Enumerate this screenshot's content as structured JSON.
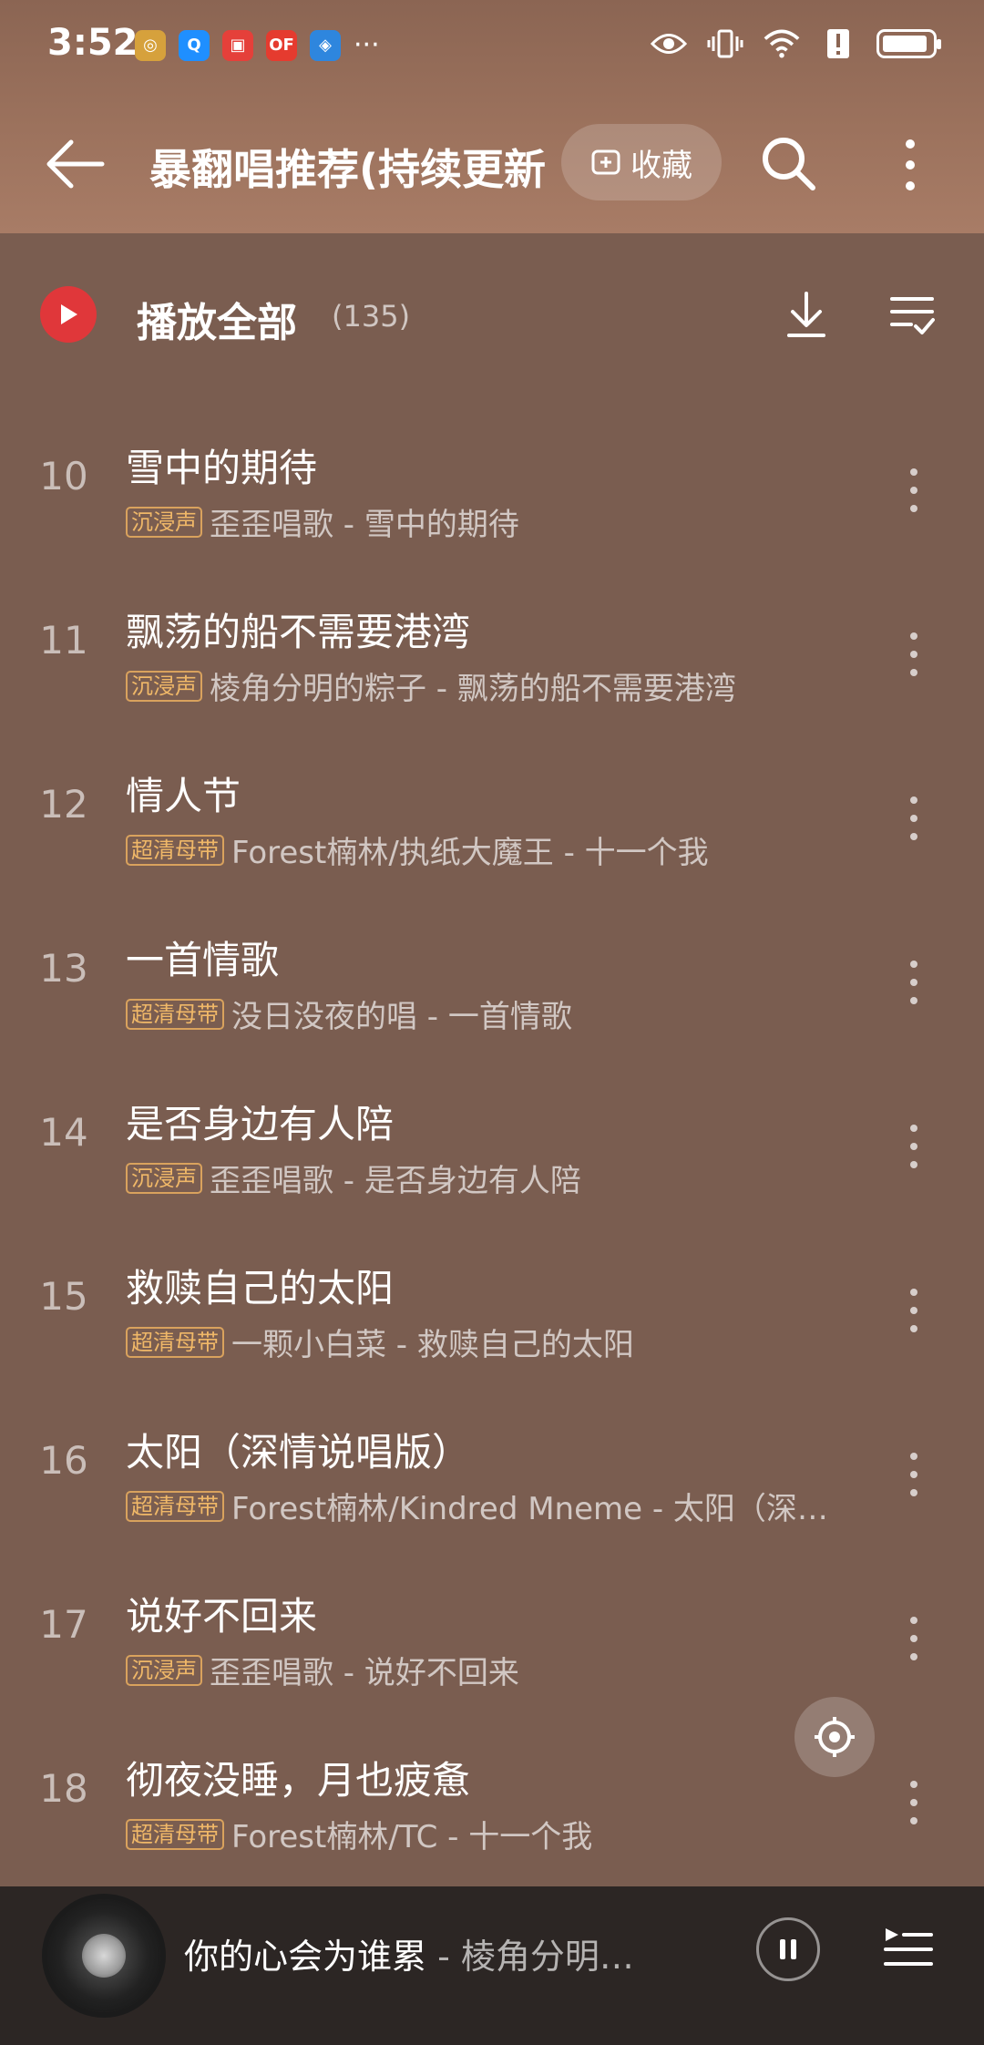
{
  "status_bar": {
    "time": "3:52",
    "apps": [
      {
        "icon": "gold-app-icon",
        "color": "#d6a13c",
        "glyph": "◎"
      },
      {
        "icon": "search-app-icon",
        "color": "#1f8fff",
        "glyph": "Q"
      },
      {
        "icon": "red-book-app-icon",
        "color": "#e5403a",
        "glyph": "▣"
      },
      {
        "icon": "of-app-icon",
        "color": "#e53b2f",
        "glyph": "OF"
      },
      {
        "icon": "blue-shield-app-icon",
        "color": "#2e86de",
        "glyph": "◈"
      }
    ],
    "more_glyph": "···"
  },
  "header": {
    "title": "暴翻唱推荐(持续更新",
    "collect_label": "收藏"
  },
  "play_all": {
    "label": "播放全部",
    "count": "(135)"
  },
  "songs": [
    {
      "index": "10",
      "title": "雪中的期待",
      "badge": "沉浸声",
      "artist": "歪歪唱歌 - 雪中的期待"
    },
    {
      "index": "11",
      "title": "飘荡的船不需要港湾",
      "badge": "沉浸声",
      "artist": "棱角分明的粽子 - 飘荡的船不需要港湾"
    },
    {
      "index": "12",
      "title": "情人节",
      "badge": "超清母带",
      "artist": "Forest楠林/执纸大魔王 - 十一个我"
    },
    {
      "index": "13",
      "title": "一首情歌",
      "badge": "超清母带",
      "artist": "没日没夜的唱 - 一首情歌"
    },
    {
      "index": "14",
      "title": "是否身边有人陪",
      "badge": "沉浸声",
      "artist": "歪歪唱歌 - 是否身边有人陪"
    },
    {
      "index": "15",
      "title": "救赎自己的太阳",
      "badge": "超清母带",
      "artist": "一颗小白菜 - 救赎自己的太阳"
    },
    {
      "index": "16",
      "title": "太阳（深情说唱版）",
      "badge": "超清母带",
      "artist": "Forest楠林/Kindred Mneme - 太阳（深…"
    },
    {
      "index": "17",
      "title": "说好不回来",
      "badge": "沉浸声",
      "artist": "歪歪唱歌 - 说好不回来"
    },
    {
      "index": "18",
      "title": "彻夜没睡，月也疲惫",
      "badge": "超清母带",
      "artist": "Forest楠林/TC - 十一个我"
    }
  ],
  "now_playing": {
    "title": "你的心会为谁累",
    "artist": " - 棱角分明…"
  },
  "colors": {
    "background": "#7a5d50",
    "play_button": "#e0373a",
    "badge": "#d9a25d",
    "mini_player": "#2c2624"
  }
}
